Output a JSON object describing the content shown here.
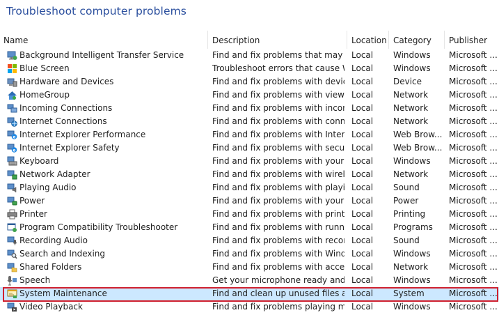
{
  "window": {
    "title": "Troubleshoot computer problems"
  },
  "columns": [
    "Name",
    "Description",
    "Location",
    "Category",
    "Publisher"
  ],
  "accent": "#2b4f9e",
  "selected_row_color": "#cce8ff",
  "highlight_border_color": "#d0202e",
  "rows": [
    {
      "name": "Background Intelligent Transfer Service",
      "description": "Find and fix problems that may p...",
      "location": "Local",
      "category": "Windows",
      "publisher": "Microsoft ...",
      "icon": "bits-icon"
    },
    {
      "name": "Blue Screen",
      "description": "Troubleshoot errors that cause Wi...",
      "location": "Local",
      "category": "Windows",
      "publisher": "Microsoft ...",
      "icon": "windows-logo-icon"
    },
    {
      "name": "Hardware and Devices",
      "description": "Find and fix problems with device...",
      "location": "Local",
      "category": "Device",
      "publisher": "Microsoft ...",
      "icon": "hardware-icon"
    },
    {
      "name": "HomeGroup",
      "description": "Find and fix problems with viewin...",
      "location": "Local",
      "category": "Network",
      "publisher": "Microsoft ...",
      "icon": "homegroup-icon"
    },
    {
      "name": "Incoming Connections",
      "description": "Find and fix problems with incom...",
      "location": "Local",
      "category": "Network",
      "publisher": "Microsoft ...",
      "icon": "network-icon"
    },
    {
      "name": "Internet Connections",
      "description": "Find and fix problems with conne...",
      "location": "Local",
      "category": "Network",
      "publisher": "Microsoft ...",
      "icon": "globe-icon"
    },
    {
      "name": "Internet Explorer Performance",
      "description": "Find and fix problems with Intern...",
      "location": "Local",
      "category": "Web Brow...",
      "publisher": "Microsoft ...",
      "icon": "ie-icon"
    },
    {
      "name": "Internet Explorer Safety",
      "description": "Find and fix problems with securi...",
      "location": "Local",
      "category": "Web Brow...",
      "publisher": "Microsoft ...",
      "icon": "ie-icon"
    },
    {
      "name": "Keyboard",
      "description": "Find and fix problems with your c...",
      "location": "Local",
      "category": "Windows",
      "publisher": "Microsoft ...",
      "icon": "keyboard-icon"
    },
    {
      "name": "Network Adapter",
      "description": "Find and fix problems with wirele...",
      "location": "Local",
      "category": "Network",
      "publisher": "Microsoft ...",
      "icon": "network-adapter-icon"
    },
    {
      "name": "Playing Audio",
      "description": "Find and fix problems with playin...",
      "location": "Local",
      "category": "Sound",
      "publisher": "Microsoft ...",
      "icon": "speaker-icon"
    },
    {
      "name": "Power",
      "description": "Find and fix problems with your c...",
      "location": "Local",
      "category": "Power",
      "publisher": "Microsoft ...",
      "icon": "power-icon"
    },
    {
      "name": "Printer",
      "description": "Find and fix problems with printi...",
      "location": "Local",
      "category": "Printing",
      "publisher": "Microsoft ...",
      "icon": "printer-icon"
    },
    {
      "name": "Program Compatibility Troubleshooter",
      "description": "Find and fix problems with runni...",
      "location": "Local",
      "category": "Programs",
      "publisher": "Microsoft ...",
      "icon": "program-icon"
    },
    {
      "name": "Recording Audio",
      "description": "Find and fix problems with record...",
      "location": "Local",
      "category": "Sound",
      "publisher": "Microsoft ...",
      "icon": "microphone-icon"
    },
    {
      "name": "Search and Indexing",
      "description": "Find and fix problems with Wind...",
      "location": "Local",
      "category": "Windows",
      "publisher": "Microsoft ...",
      "icon": "search-icon"
    },
    {
      "name": "Shared Folders",
      "description": "Find and fix problems with access...",
      "location": "Local",
      "category": "Network",
      "publisher": "Microsoft ...",
      "icon": "shared-folder-icon"
    },
    {
      "name": "Speech",
      "description": "Get your microphone ready and f...",
      "location": "Local",
      "category": "Windows",
      "publisher": "Microsoft ...",
      "icon": "speech-icon"
    },
    {
      "name": "System Maintenance",
      "description": "Find and clean up unused files an...",
      "location": "Local",
      "category": "System",
      "publisher": "Microsoft ...",
      "icon": "maintenance-icon",
      "selected": true
    },
    {
      "name": "Video Playback",
      "description": "Find and fix problems playing mo...",
      "location": "Local",
      "category": "Windows",
      "publisher": "Microsoft ...",
      "icon": "video-icon"
    }
  ]
}
